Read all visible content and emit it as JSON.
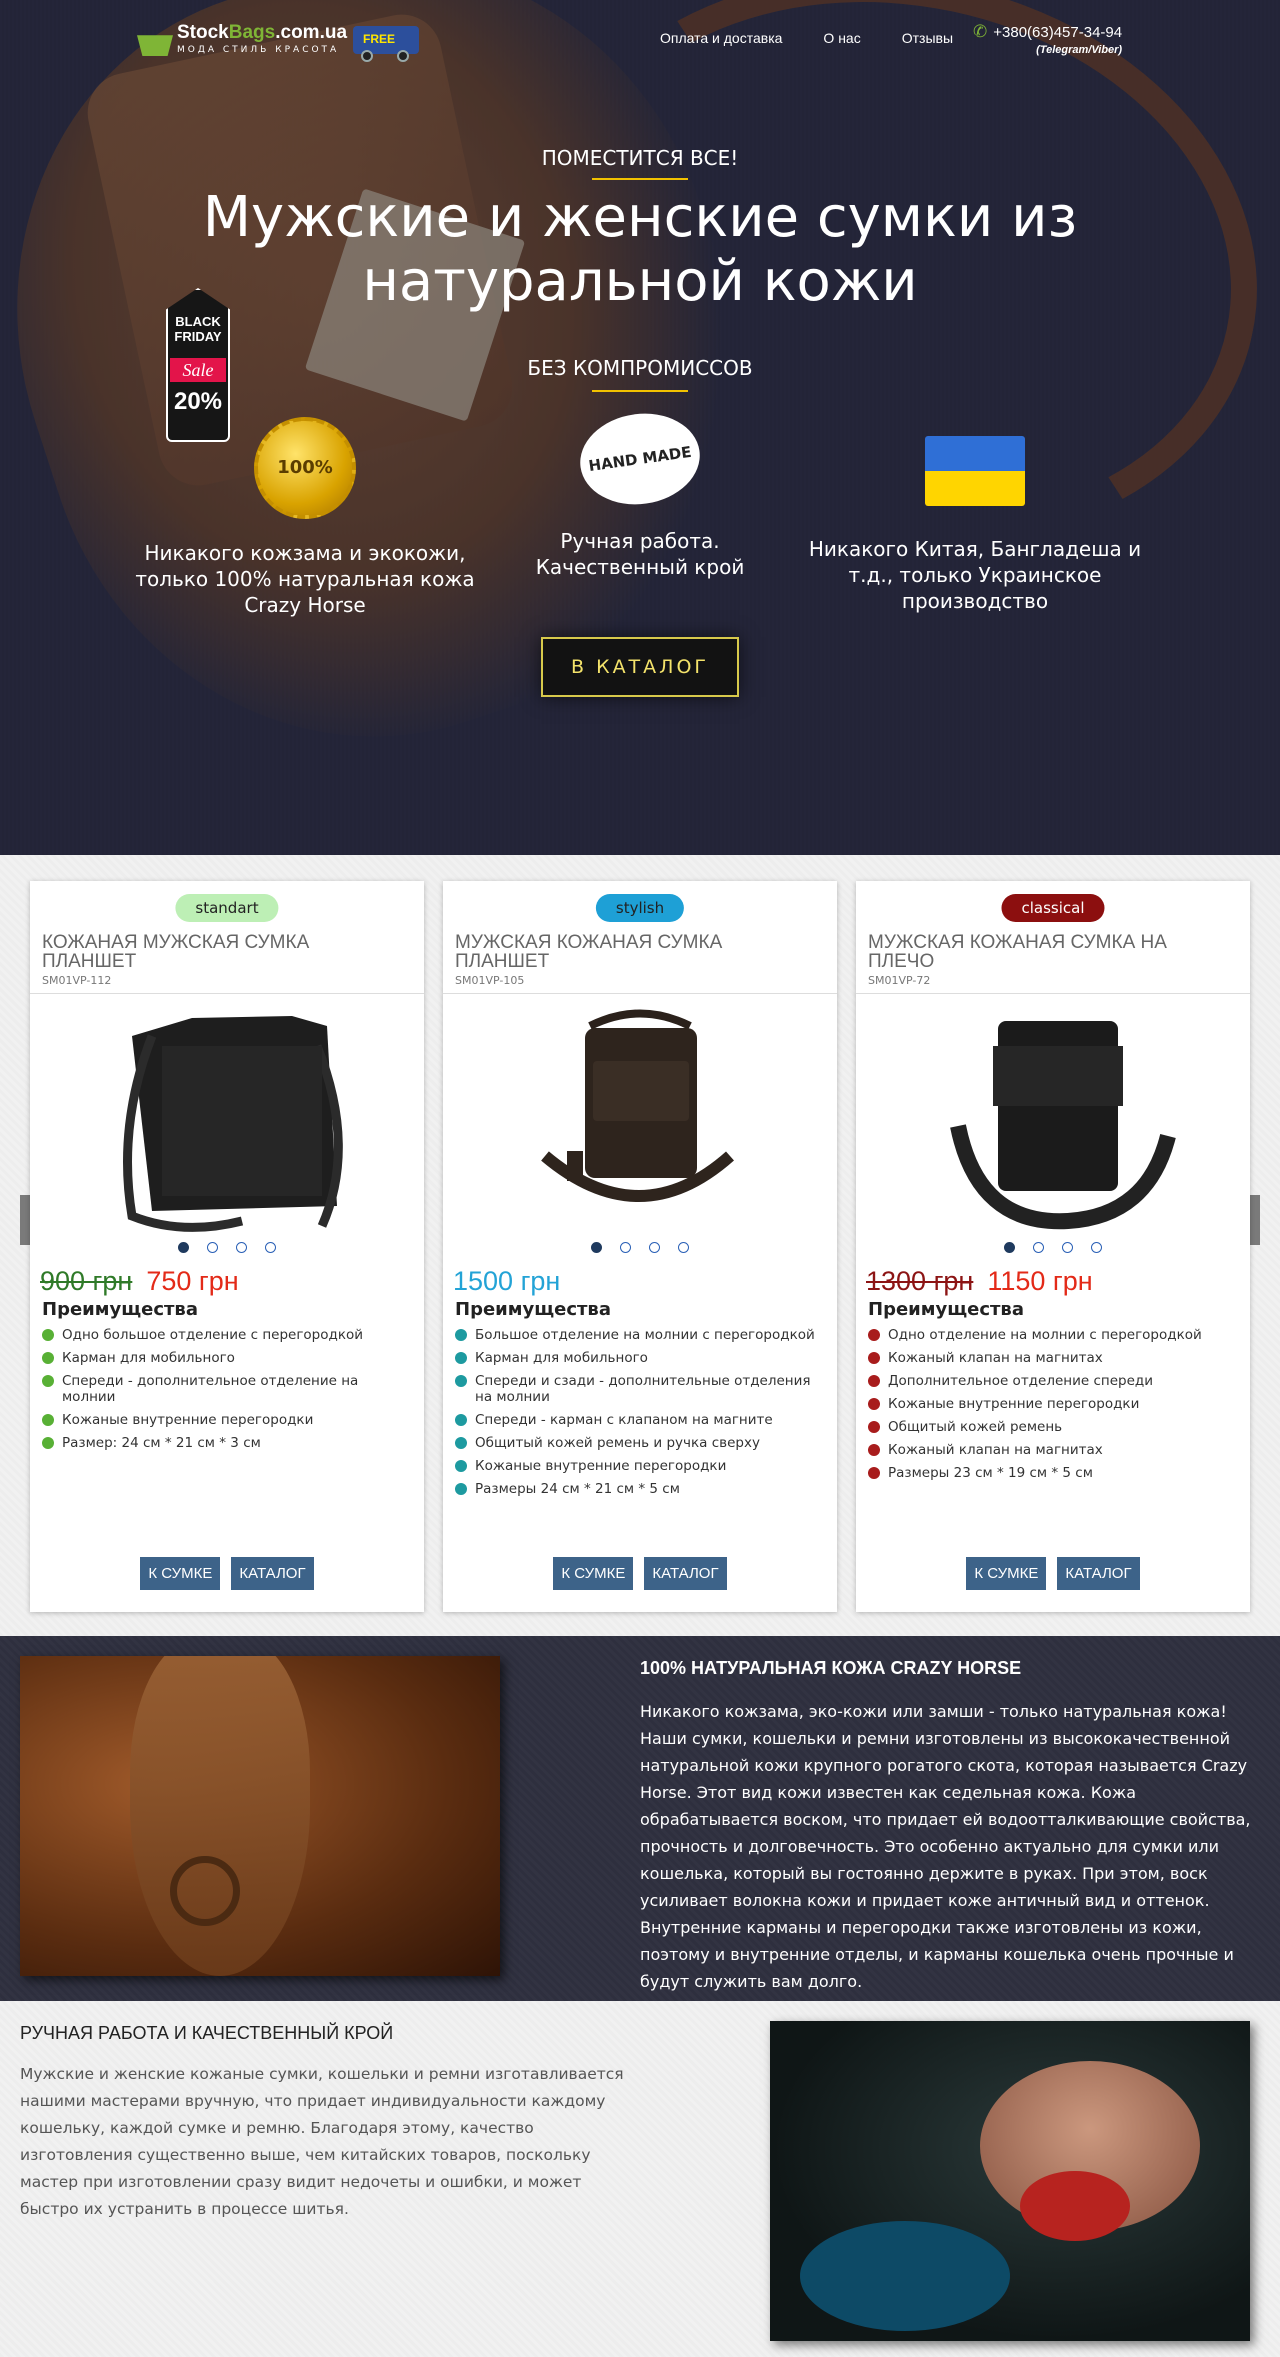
{
  "header": {
    "logo_brand_part1": "Stock",
    "logo_brand_part2": "Bags",
    "logo_brand_part3": ".com.ua",
    "logo_tagline": "МОДА  СТИЛЬ  КРАСОТА",
    "free_badge": "FREE",
    "nav": [
      "Оплата и доставка",
      "О нас",
      "Отзывы"
    ],
    "phone": "+380(63)457-34-94",
    "phone_note": "(Telegram/Viber)"
  },
  "hero": {
    "kicker": "ПОМЕСТИТСЯ ВСЕ!",
    "title": "Мужские и женские сумки из натуральной кожи",
    "subtitle": "БЕЗ КОМПРОМИССОВ",
    "bf_line1": "BLACK",
    "bf_line2": "FRIDAY",
    "bf_sale": "Sale",
    "bf_pct": "20%",
    "medal_text": "100%",
    "handmade_text": "HAND MADE",
    "features": [
      "Никакого кожзама и экокожи, только 100% натуральная кожа Crazy Horse",
      "Ручная работа. Качественный крой",
      "Никакого Китая, Бангладеша и т.д., только Украинское производство"
    ],
    "cta": "В КАТАЛОГ",
    "accent_color": "#f2c200"
  },
  "products": [
    {
      "badge": "standart",
      "badge_color": "#bdefb5",
      "title": "Кожаная мужская сумка планшет",
      "sku": "SM01VP-112",
      "old_price": "900 грн",
      "price": "750 грн",
      "advantages_title": "Преимущества",
      "bullet_color": "#58b035",
      "advantages": [
        "Одно большое отделение с перегородкой",
        "Карман для мобильного",
        "Спереди - дополнительное отделение на молнии",
        "Кожаные внутренние перегородки",
        "Размер: 24 см * 21 см * 3 см"
      ],
      "btn_bag": "К СУМКЕ",
      "btn_catalog": "КАТАЛОГ"
    },
    {
      "badge": "stylish",
      "badge_color": "#1ea0d6",
      "title": "Мужская кожаная сумка планшет",
      "sku": "SM01VP-105",
      "old_price": "",
      "price": "1500 грн",
      "advantages_title": "Преимущества",
      "bullet_color": "#1d9aa0",
      "advantages": [
        "Большое отделение на молнии с перегородкой",
        "Карман для мобильного",
        "Спереди и сзади - дополнительные отделения на молнии",
        "Спереди - карман с клапаном на магните",
        "Общитый кожей ремень и ручка сверху",
        "Кожаные внутренние перегородки",
        "Размеры 24 см * 21 см * 5 см"
      ],
      "btn_bag": "К СУМКЕ",
      "btn_catalog": "КАТАЛОГ"
    },
    {
      "badge": "classical",
      "badge_color": "#8c0f0f",
      "title": "Мужская кожаная сумка на плечо",
      "sku": "SM01VP-72",
      "old_price": "1300 грн",
      "price": "1150 грн",
      "advantages_title": "Преимущества",
      "bullet_color": "#a81c1c",
      "advantages": [
        "Одно отделение на молнии с перегородкой",
        "Кожаный клапан на магнитах",
        "Дополнительное отделение спереди",
        "Кожаные внутренние перегородки",
        "Общитый кожей ремень",
        "Кожаный клапан на магнитах",
        "Размеры 23 см * 19 см * 5 см"
      ],
      "btn_bag": "К СУМКЕ",
      "btn_catalog": "КАТАЛОГ"
    }
  ],
  "carousel": {
    "prev_icon": "chevron-left-icon",
    "next_icon": "chevron-right-icon",
    "prev": "❮",
    "next": "❯"
  },
  "leather_section": {
    "title": "100% НАТУРАЛЬНАЯ КОЖА CRAZY HORSE",
    "text": "Никакого кожзама, эко-кожи или замши - только натуральная кожа! Наши сумки, кошельки и ремни изготовлены из высококачественной натуральной кожи крупного рогатого скота, которая называется Crazy Horse. Этот вид кожи известен как седельная кожа. Кожа обрабатывается воском, что придает ей водоотталкивающие свойства, прочность и долговечность. Это особенно актуально для сумки или кошелька, который вы гостоянно держите в руках. При этом, воск усиливает волокна кожи и придает коже античный вид и оттенок. Внутренние карманы и перегородки также изготовлены из кожи, поэтому и внутренние отделы, и карманы кошелька очень прочные и будут служить вам долго."
  },
  "handmade_section": {
    "title": "РУЧНАЯ РАБОТА И КАЧЕСТВЕННЫЙ КРОЙ",
    "text": "Мужские и женские кожаные сумки, кошельки и ремни изготавливается нашими мастерами вручную, что придает индивидуальности каждому кошельку, каждой сумке и ремню. Благодаря этому, качество изготовления существенно выше, чем китайских товаров, поскольку мастер при изготовлении сразу видит недочеты и ошибки, и может быстро их устранить в процессе шитья."
  }
}
